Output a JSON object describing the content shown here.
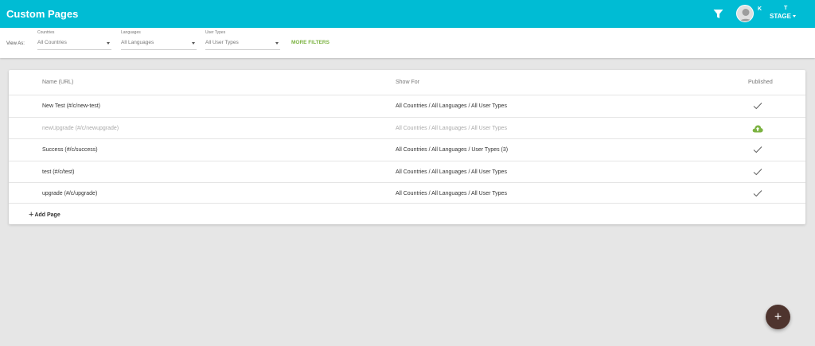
{
  "header": {
    "title": "Custom Pages",
    "user_initial_first": "K",
    "user_initial_last": "T",
    "environment": "STAGE",
    "icons": {
      "filter": "filter-funnel-icon",
      "avatar": "user-avatar-icon"
    }
  },
  "filters": {
    "view_as_label": "View As:",
    "countries": {
      "label": "Countries",
      "value": "All Countries"
    },
    "languages": {
      "label": "Languages",
      "value": "All Languages"
    },
    "user_types": {
      "label": "User Types",
      "value": "All User Types"
    },
    "more_filters": "MORE FILTERS"
  },
  "table": {
    "columns": {
      "name": "Name (URL)",
      "show_for": "Show For",
      "published": "Published"
    },
    "rows": [
      {
        "name": "New Test (#/c/new-test)",
        "show_for": "All Countries / All Languages / All User Types",
        "published": "check"
      },
      {
        "name": "newUpgrade (#/c/newupgrade)",
        "show_for": "All Countries / All Languages / All User Types",
        "published": "cloud-upload"
      },
      {
        "name": "Success (#/c/success)",
        "show_for": "All Countries / All Languages / User Types (3)",
        "published": "check"
      },
      {
        "name": "test (#/c/test)",
        "show_for": "All Countries / All Languages / All User Types",
        "published": "check"
      },
      {
        "name": "upgrade (#/c/upgrade)",
        "show_for": "All Countries / All Languages / All User Types",
        "published": "check"
      }
    ],
    "add_page": "Add Page"
  },
  "fab": {
    "label": "+"
  },
  "colors": {
    "header": "#00bcd4",
    "accent_green": "#7cb342",
    "fab": "#4e342e"
  }
}
